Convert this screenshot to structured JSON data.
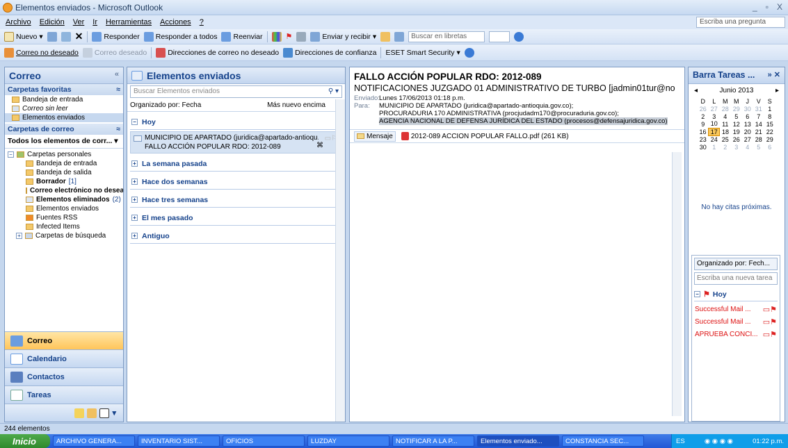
{
  "window": {
    "title": "Elementos enviados - Microsoft Outlook"
  },
  "menu": {
    "items": [
      "Archivo",
      "Edición",
      "Ver",
      "Ir",
      "Herramientas",
      "Acciones",
      "?"
    ],
    "ask": "Escriba una pregunta"
  },
  "toolbar1": {
    "nuevo": "Nuevo",
    "responder": "Responder",
    "responder_todos": "Responder a todos",
    "reenviar": "Reenviar",
    "enviar_recibir": "Enviar y recibir",
    "buscar_libretas": "Buscar en libretas"
  },
  "toolbar2": {
    "no_deseado": "Correo no deseado",
    "deseado": "Correo deseado",
    "direcciones_no": "Direcciones de correo no deseado",
    "direcciones_conf": "Direcciones de confianza",
    "eset": "ESET Smart Security"
  },
  "nav": {
    "title": "Correo",
    "favoritos_header": "Carpetas favoritas",
    "favoritos": [
      "Bandeja de entrada",
      "Correo sin leer",
      "Elementos enviados"
    ],
    "carpetas_header": "Carpetas de correo",
    "all_mail": "Todos los elementos de corr...",
    "personal": "Carpetas personales",
    "folders": [
      {
        "name": "Bandeja de entrada",
        "count": ""
      },
      {
        "name": "Bandeja de salida",
        "count": ""
      },
      {
        "name": "Borrador",
        "count": "[1]"
      },
      {
        "name": "Correo electrónico no desea",
        "count": ""
      },
      {
        "name": "Elementos eliminados",
        "count": "(2)"
      },
      {
        "name": "Elementos enviados",
        "count": ""
      },
      {
        "name": "Fuentes RSS",
        "count": ""
      },
      {
        "name": "Infected Items",
        "count": ""
      },
      {
        "name": "Carpetas de búsqueda",
        "count": ""
      }
    ],
    "buttons": [
      "Correo",
      "Calendario",
      "Contactos",
      "Tareas"
    ]
  },
  "list": {
    "title": "Elementos enviados",
    "search_placeholder": "Buscar Elementos enviados",
    "sort_left": "Organizado por: Fecha",
    "sort_right": "Más nuevo encima",
    "groups": [
      "Hoy",
      "La semana pasada",
      "Hace dos semanas",
      "Hace tres semanas",
      "El mes pasado",
      "Antiguo"
    ],
    "message": {
      "from": "MUNICIPIO DE APARTADO (juridica@apartado-antioqu...",
      "subject": "FALLO ACCIÓN POPULAR RDO: 2012-089"
    }
  },
  "reading": {
    "subject": "FALLO ACCIÓN POPULAR RDO: 2012-089",
    "from": "NOTIFICACIONES JUZGADO 01 ADMINISTRATIVO DE TURBO [jadmin01tur@no",
    "sent_label": "Enviado:",
    "sent": "Lunes 17/06/2013 01:18 p.m.",
    "to_label": "Para:",
    "to": [
      "MUNICIPIO DE APARTADO (juridica@apartado-antioquia.gov.co);",
      "PROCURADURIA 170 ADMINISTRATIVA (procjudadm170@procuraduria.gov.co);",
      "AGENCIA NACIONAL DE DEFENSA JURÍDICA DEL ESTADO (procesos@defensajuridica.gov.co)"
    ],
    "tab_message": "Mensaje",
    "attachment": "2012-089 ACCION POPULAR FALLO.pdf (261 KB)"
  },
  "todo": {
    "title": "Barra Tareas ...",
    "month": "Junio 2013",
    "weekdays": [
      "D",
      "L",
      "M",
      "M",
      "J",
      "V",
      "S"
    ],
    "weeks": [
      [
        "26",
        "27",
        "28",
        "29",
        "30",
        "31",
        "1"
      ],
      [
        "2",
        "3",
        "4",
        "5",
        "6",
        "7",
        "8"
      ],
      [
        "9",
        "10",
        "11",
        "12",
        "13",
        "14",
        "15"
      ],
      [
        "16",
        "17",
        "18",
        "19",
        "20",
        "21",
        "22"
      ],
      [
        "23",
        "24",
        "25",
        "26",
        "27",
        "28",
        "29"
      ],
      [
        "30",
        "1",
        "2",
        "3",
        "4",
        "5",
        "6"
      ]
    ],
    "no_citas": "No hay citas próximas.",
    "sort": "Organizado por: Fech...",
    "new_task": "Escriba una nueva tarea",
    "today": "Hoy",
    "tasks": [
      "Successful Mail ...",
      "Successful Mail ...",
      "APRUEBA CONCI..."
    ]
  },
  "status": {
    "text": "244 elementos"
  },
  "taskbar": {
    "start": "Inicio",
    "items": [
      "ARCHIVO GENERA...",
      "INVENTARIO SIST...",
      "OFICIOS",
      "LUZDAY",
      "NOTIFICAR A LA P...",
      "Elementos enviado...",
      "CONSTANCIA SEC..."
    ],
    "lang": "ES",
    "time": "01:22 p.m."
  }
}
